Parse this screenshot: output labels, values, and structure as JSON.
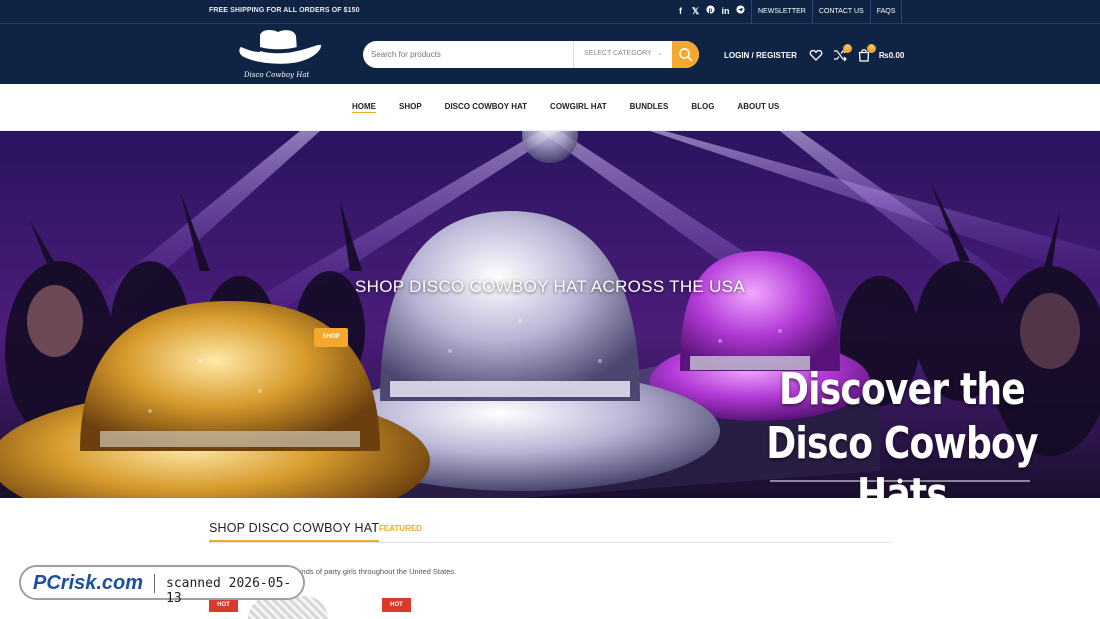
{
  "topbar": {
    "promo": "FREE SHIPPING FOR ALL ORDERS OF $150",
    "social_icons": [
      "facebook-icon",
      "x-icon",
      "pinterest-icon",
      "linkedin-icon",
      "telegram-icon"
    ],
    "links": [
      "NEWSLETTER",
      "CONTACT US",
      "FAQS"
    ]
  },
  "header": {
    "logo_text": "Disco Cowboy Hat",
    "search_placeholder": "Search for products",
    "category_label": "SELECT CATEGORY",
    "login_label": "LOGIN / REGISTER",
    "wishlist_icon": "heart-icon",
    "compare_count": "0",
    "cart_count": "0",
    "cart_total": "₨0.00"
  },
  "nav": {
    "items": [
      "HOME",
      "SHOP",
      "DISCO COWBOY HAT",
      "COWGIRL HAT",
      "BUNDLES",
      "BLOG",
      "ABOUT US"
    ],
    "active": "HOME"
  },
  "hero": {
    "headline": "SHOP DISCO COWBOY HAT ACROSS THE USA",
    "button_label": "SHOP",
    "overlay_line1": "Discover the",
    "overlay_line2": "Disco Cowboy Hats"
  },
  "products": {
    "tab_main": "SHOP DISCO COWBOY HAT",
    "tab_featured": "FEATURED",
    "description": "owboy hat picked by thousands of party girls throughout the United States.",
    "badges": [
      "HOT",
      "HOT"
    ]
  },
  "watermark": {
    "brand": "PCrisk.com",
    "scan_text": "scanned 2026-05-13"
  },
  "colors": {
    "navy": "#0f2345",
    "accent": "#f4a92d",
    "hot": "#d93a2b"
  }
}
